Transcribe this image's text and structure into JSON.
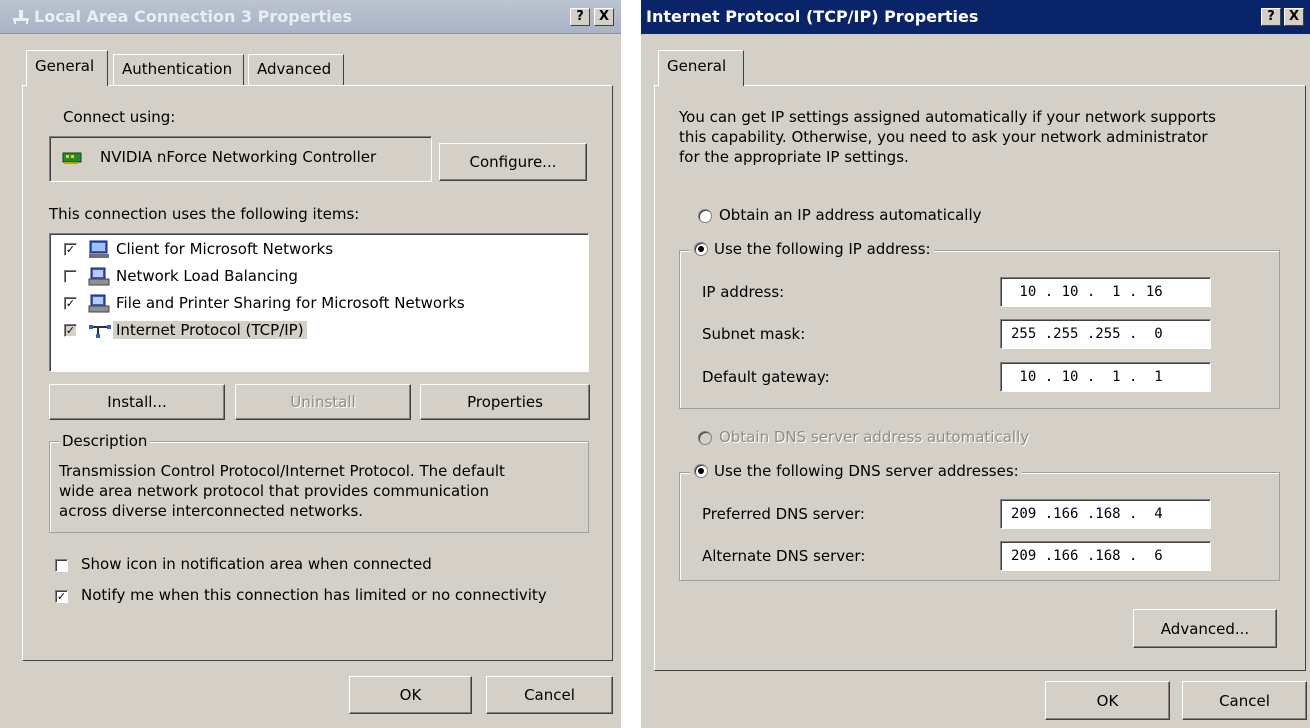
{
  "left_window": {
    "title": "Local Area Connection 3 Properties",
    "help_btn": "?",
    "close_btn": "X",
    "tabs": [
      {
        "label": "General",
        "selected": true
      },
      {
        "label": "Authentication",
        "selected": false
      },
      {
        "label": "Advanced",
        "selected": false
      }
    ],
    "connect_using_label": "Connect using:",
    "adapter_name": "NVIDIA nForce Networking Controller",
    "configure_button": "Configure...",
    "items_label": "This connection uses the following items:",
    "items": [
      {
        "label": "Client for Microsoft Networks",
        "checked": true,
        "icon": "network-client-icon"
      },
      {
        "label": "Network Load Balancing",
        "checked": false,
        "icon": "network-service-icon"
      },
      {
        "label": "File and Printer Sharing for Microsoft Networks",
        "checked": true,
        "icon": "network-service-icon"
      },
      {
        "label": "Internet Protocol (TCP/IP)",
        "checked": true,
        "icon": "network-protocol-icon",
        "selected": true
      }
    ],
    "install_button": "Install...",
    "uninstall_button": "Uninstall",
    "properties_button": "Properties",
    "description_caption": "Description",
    "description_lines": [
      "Transmission Control Protocol/Internet Protocol. The default",
      "wide area network protocol that provides communication",
      "across diverse interconnected networks."
    ],
    "show_icon_label": "Show icon in notification area when connected",
    "show_icon_checked": false,
    "notify_label": "Notify me when this connection has limited or no connectivity",
    "notify_checked": true,
    "ok_button": "OK",
    "cancel_button": "Cancel"
  },
  "right_window": {
    "title": "Internet Protocol (TCP/IP) Properties",
    "help_btn": "?",
    "close_btn": "X",
    "tab_general": "General",
    "intro_lines": [
      "You can get IP settings assigned automatically if your network supports",
      "this capability. Otherwise, you need to ask your network administrator",
      "for the appropriate IP settings."
    ],
    "ip_auto_label": "Obtain an IP address automatically",
    "ip_manual_label": "Use the following IP address:",
    "ip_mode": "manual",
    "ip_address_label": "IP address:",
    "ip_address_value": " 10 . 10 .  1 . 16",
    "subnet_label": "Subnet mask:",
    "subnet_value": "255 .255 .255 .  0",
    "gateway_label": "Default gateway:",
    "gateway_value": " 10 . 10 .  1 .  1",
    "dns_auto_label": "Obtain DNS server address automatically",
    "dns_manual_label": "Use the following DNS server addresses:",
    "dns_mode": "manual",
    "preferred_dns_label": "Preferred DNS server:",
    "preferred_dns_value": "209 .166 .168 .  4",
    "alternate_dns_label": "Alternate DNS server:",
    "alternate_dns_value": "209 .166 .168 .  6",
    "advanced_button": "Advanced...",
    "ok_button": "OK",
    "cancel_button": "Cancel"
  },
  "colors": {
    "dialog_face": "#d4d0c8",
    "active_title": "#0a246a",
    "inactive_title": "#a8b2c4",
    "disabled_text": "#8e8c88"
  }
}
